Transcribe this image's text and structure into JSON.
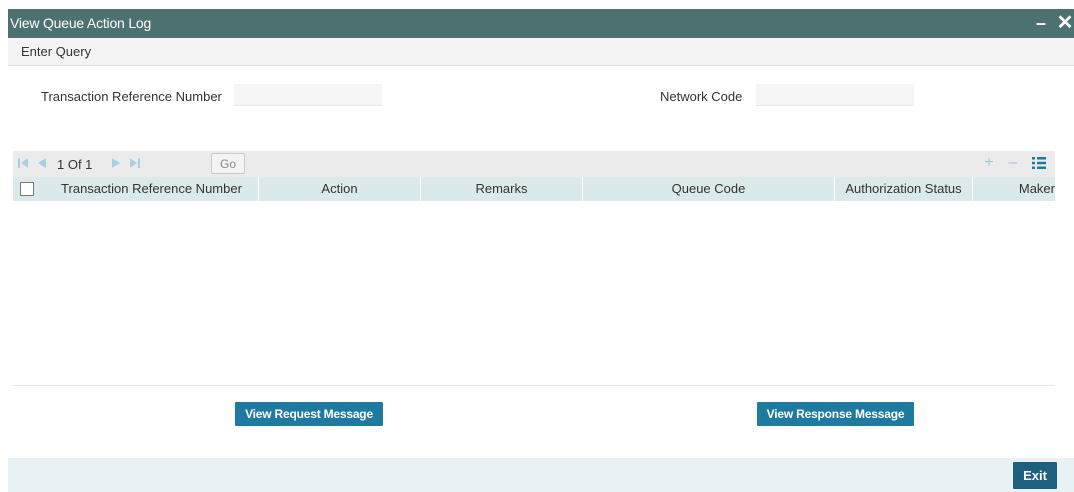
{
  "window": {
    "title": "View Queue Action Log",
    "minimize_glyph": "–",
    "close_glyph": "✕"
  },
  "menu": {
    "enter_query": "Enter Query"
  },
  "form": {
    "transaction_reference_label": "Transaction Reference Number",
    "transaction_reference_value": "",
    "network_code_label": "Network Code",
    "network_code_value": ""
  },
  "grid": {
    "pager": {
      "current_page": "1",
      "of_label": "Of",
      "total_pages": "1",
      "display": "1 Of 1",
      "go_label": "Go"
    },
    "tools": {
      "add_glyph": "+",
      "remove_glyph": "–",
      "columns_glyph": "☷"
    },
    "columns": [
      "Transaction Reference Number",
      "Action",
      "Remarks",
      "Queue Code",
      "Authorization Status",
      "Maker"
    ],
    "rows": []
  },
  "buttons": {
    "view_request": "View Request Message",
    "view_response": "View Response Message",
    "exit": "Exit"
  },
  "colors": {
    "titlebar": "#4d7171",
    "accent_button": "#1f7aa0",
    "exit_button": "#1f5f7f",
    "grid_header": "#dbe9ea",
    "footer": "#e8f2f4"
  }
}
